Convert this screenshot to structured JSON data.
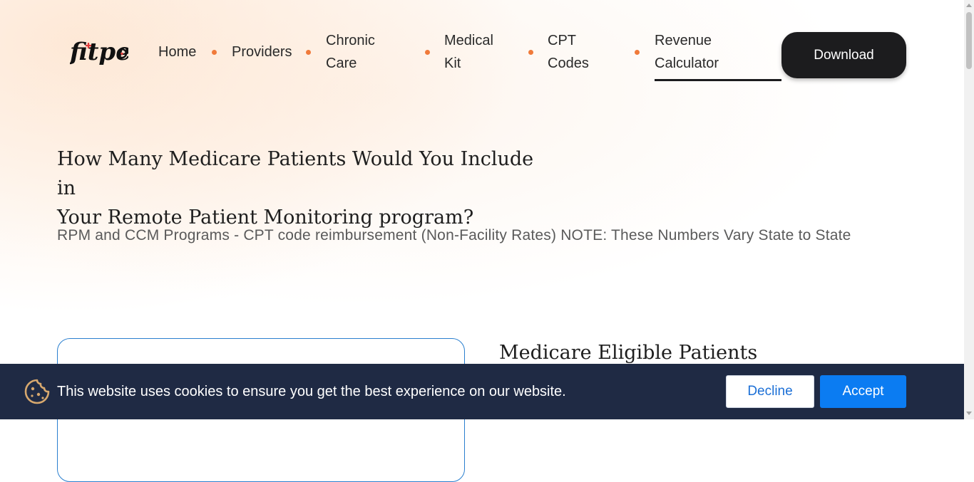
{
  "brand": {
    "logo_text": "fitpeo"
  },
  "nav": {
    "items": [
      {
        "label_line1": "Home",
        "label_line2": ""
      },
      {
        "label_line1": "Providers",
        "label_line2": ""
      },
      {
        "label_line1": "Chronic",
        "label_line2": "Care"
      },
      {
        "label_line1": "Medical",
        "label_line2": "Kit"
      },
      {
        "label_line1": "CPT",
        "label_line2": "Codes"
      },
      {
        "label_line1": "Revenue",
        "label_line2": "Calculator",
        "active": true
      }
    ],
    "download_label": "Download"
  },
  "main": {
    "headline_line1": "How Many Medicare Patients Would You Include in",
    "headline_line2": "Your Remote Patient Monitoring program?",
    "subhead": "RPM and CCM Programs - CPT code reimbursement (Non-Facility Rates) NOTE: These Numbers Vary State to State",
    "eligible_title": "Medicare Eligible Patients"
  },
  "cookie": {
    "message": "This website uses cookies to ensure you get the best experience on our website.",
    "decline_label": "Decline",
    "accept_label": "Accept",
    "icon": "cookie-icon"
  },
  "colors": {
    "accent_dot": "#f07a3a",
    "dark_button": "#1c1c1e",
    "cookie_bar": "#1f2a44",
    "accept": "#0b7cf2",
    "decline_text": "#1b6fd6",
    "card_border": "#2a7fcf"
  }
}
